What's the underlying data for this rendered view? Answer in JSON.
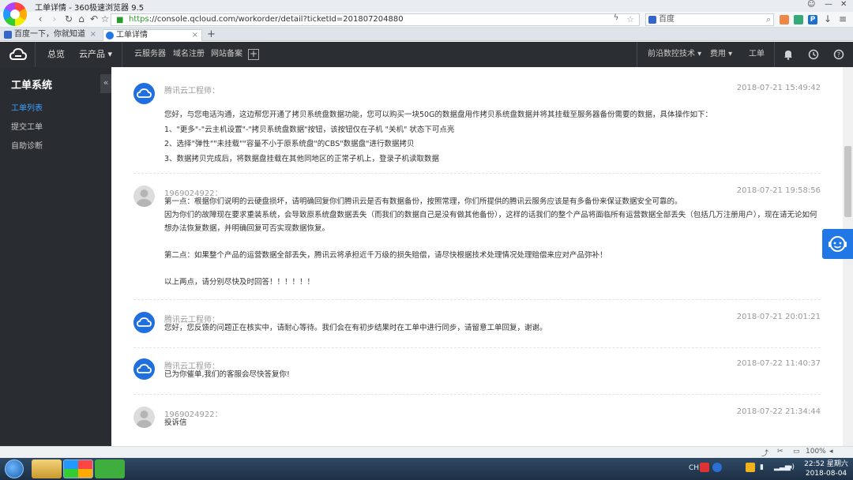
{
  "browser": {
    "window_title": "工单详情 - 360极速浏览器 9.5",
    "url_scheme": "https",
    "url_rest": "://console.qcloud.com/workorder/detail?ticketId=201807204880",
    "search_placeholder": "百度",
    "tabs": [
      {
        "label": "百度一下，你就知道"
      },
      {
        "label": "工单详情"
      }
    ],
    "status_bar": {
      "zoom": "100%"
    }
  },
  "header": {
    "nav": [
      {
        "label": "总览"
      },
      {
        "label": "云产品 ▾"
      },
      {
        "label": "云服务器"
      },
      {
        "label": "域名注册"
      },
      {
        "label": "网站备案"
      }
    ],
    "right": [
      {
        "label": "前沿数控技术 ▾"
      },
      {
        "label": "费用 ▾"
      },
      {
        "label": "工单"
      }
    ]
  },
  "sidebar": {
    "title": "工单系统",
    "collapse_label": "«",
    "items": [
      {
        "label": "工单列表",
        "active": true
      },
      {
        "label": "提交工单"
      },
      {
        "label": "自助诊断"
      }
    ]
  },
  "messages": [
    {
      "author": "腾讯云工程师：",
      "time": "2018-07-21 15:49:42",
      "lines": [
        "您好，与您电话沟通，这边帮您开通了拷贝系统盘数据功能，您可以购买一块50G的数据盘用作拷贝系统盘数据并将其挂载至服务器备份需要的数据，具体操作如下：",
        "1、\"更多\"-\"云主机设置\"-\"拷贝系统盘数据\"按钮，该按钮仅在子机 \"关机\" 状态下可点亮",
        "2、选择\"弹性\"\"未挂载\"\"容量不小于原系统盘\"的CBS\"数据盘\"进行数据拷贝",
        "3、数据拷贝完成后，将数据盘挂载在其他同地区的正常子机上，登录子机读取数据"
      ]
    },
    {
      "author": "1969024922：",
      "time": "2018-07-21 19:58:56",
      "lines": [
        "第一点：根据你们说明的云硬盘损坏，请明确回复你们腾讯云是否有数据备份，按照常理，你们所提供的腾讯云服务应该是有多备份来保证数据安全可靠的。",
        "因为你们的故障现在要求重装系统，会导致原系统盘数据丢失（而我们的数据自己是没有做其他备份），这样的话我们的整个产品将面临所有运营数据全部丢失（包括几万注册用户），现在请无论如何想办法恢复数据，并明确回复可否实现数据恢复。",
        "",
        "第二点：如果整个产品的运营数据全部丢失，腾讯云将承担近千万级的损失赔偿，请尽快根据技术处理情况处理赔偿来应对产品弥补！",
        "",
        "以上两点，请分别尽快及时回答！！！！！！"
      ]
    },
    {
      "author": "腾讯云工程师：",
      "time": "2018-07-21 20:01:21",
      "lines": [
        "您好，您反馈的问题正在核实中，请耐心等待。我们会在有初步结果时在工单中进行同步，请留意工单回复，谢谢。"
      ]
    },
    {
      "author": "腾讯云工程师：",
      "time": "2018-07-22 11:40:37",
      "lines": [
        "已为你催单,我们的客服会尽快答复你!"
      ]
    },
    {
      "author": "1969024922：",
      "time": "2018-07-22 21:34:44",
      "lines": [
        "投诉信"
      ]
    }
  ],
  "taskbar": {
    "tray_lang": "CH",
    "clock_time": "22:52 星期六",
    "clock_date": "2018-08-04"
  },
  "colors": {
    "accent": "#2277e6",
    "header_bg": "#2b2e33",
    "sidebar_bg": "#292c31",
    "active_link": "#3fa0ff"
  }
}
